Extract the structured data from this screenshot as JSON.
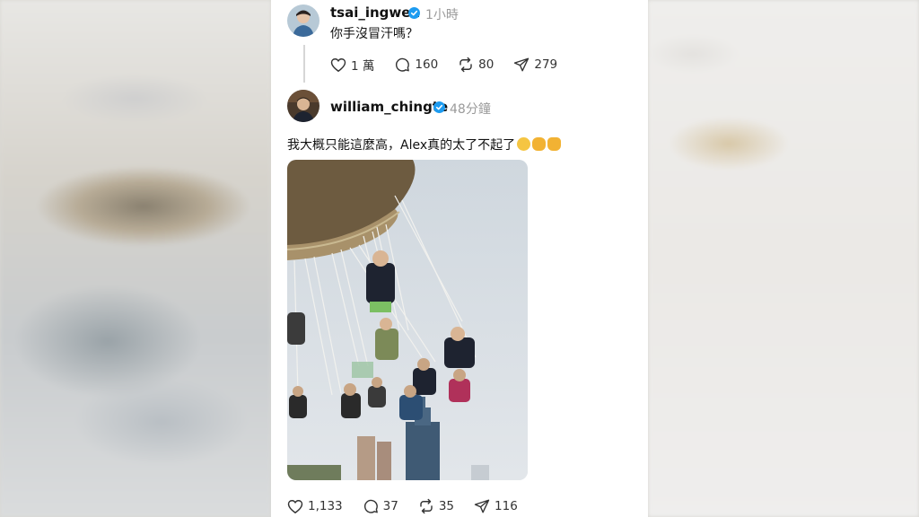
{
  "post1": {
    "username": "tsai_ingwen",
    "time": "1小時",
    "text": "你手沒冒汗嗎？",
    "likes": "1 萬",
    "replies": "160",
    "reposts": "80",
    "shares": "279"
  },
  "post2": {
    "username": "william_chingte",
    "time": "48分鐘",
    "text": "我大概只能這麼高，Alex真的太了不起了",
    "likes": "1,133",
    "replies": "37",
    "reposts": "35",
    "shares": "116"
  },
  "icons": {
    "verified": "verified-badge-icon",
    "like": "heart-icon",
    "reply": "comment-icon",
    "repost": "repost-icon",
    "share": "send-icon"
  },
  "colors": {
    "verified": "#1d9bf0",
    "text": "#111111",
    "muted": "#9a9a9a"
  }
}
